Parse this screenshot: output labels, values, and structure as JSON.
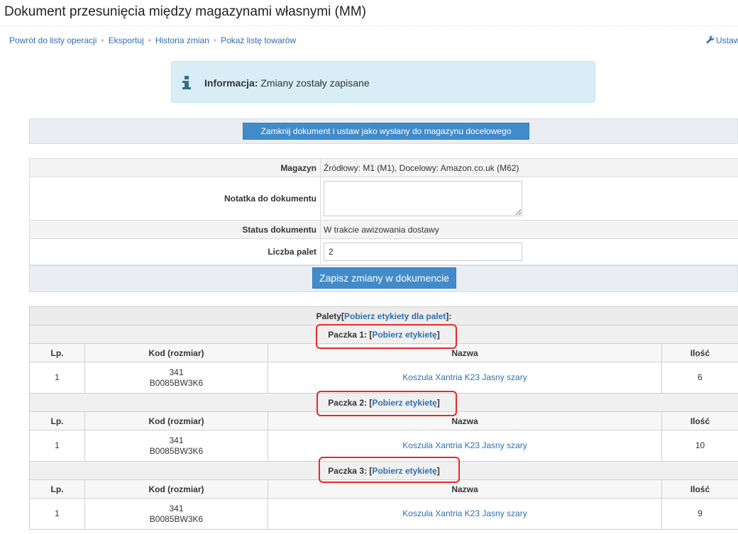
{
  "page": {
    "title": "Dokument przesunięcia między magazynami własnymi (MM)"
  },
  "subnav": {
    "items": [
      "Powrót do listy operacji",
      "Eksportuj",
      "Historia zmian",
      "Pokaż listę towarów"
    ],
    "separator": "•",
    "settings_label": "Ustaw"
  },
  "info": {
    "label": "Informacja:",
    "message": " Zmiany zostały zapisane"
  },
  "close_button_label": "Zamknij dokument i ustaw jako wysłany do magazynu docelowego",
  "form": {
    "warehouse_label": "Magazyn",
    "warehouse_value": "Źródłowy: M1 (M1), Docelowy: Amazon.co.uk (M62)",
    "note_label": "Notatka do dokumentu",
    "note_value": "",
    "status_label": "Status dokumentu",
    "status_value": "W trakcie awizowania dostawy",
    "pallets_label": "Liczba palet",
    "pallets_value": "2",
    "save_button_label": "Zapisz zmiany w dokumencie"
  },
  "pallets": {
    "header_prefix": "Palety[",
    "header_link": "Pobierz etykiety dla palet",
    "header_suffix": "]:",
    "columns": {
      "lp": "Lp.",
      "code": "Kod (rozmiar)",
      "name": "Nazwa",
      "qty": "Ilość"
    },
    "packages": [
      {
        "title": "Paczka 1:",
        "link_prefix": "[",
        "link": "Pobierz etykietę",
        "link_suffix": "]",
        "items": [
          {
            "lp": "1",
            "code": "341",
            "code_size": "B0085BW3K6",
            "name": "Koszula Xantria K23 Jasny szary",
            "qty": "6"
          }
        ]
      },
      {
        "title": "Paczka 2:",
        "link_prefix": "[",
        "link": "Pobierz etykietę",
        "link_suffix": "]",
        "items": [
          {
            "lp": "1",
            "code": "341",
            "code_size": "B0085BW3K6",
            "name": "Koszula Xantria K23 Jasny szary",
            "qty": "10"
          }
        ]
      },
      {
        "title": "Paczka 3:",
        "link_prefix": "[",
        "link": "Pobierz etykietę",
        "link_suffix": "]",
        "items": [
          {
            "lp": "1",
            "code": "341",
            "code_size": "B0085BW3K6",
            "name": "Koszula Xantria K23 Jasny szary",
            "qty": "9"
          }
        ]
      }
    ]
  },
  "colors": {
    "link": "#2f6fb0",
    "button_blue": "#428bca",
    "info_background": "#d9edf7",
    "info_icon": "#31708f",
    "callout_red": "#e8282b"
  },
  "icons": {
    "info": "info-icon",
    "settings": "wrench-icon"
  }
}
